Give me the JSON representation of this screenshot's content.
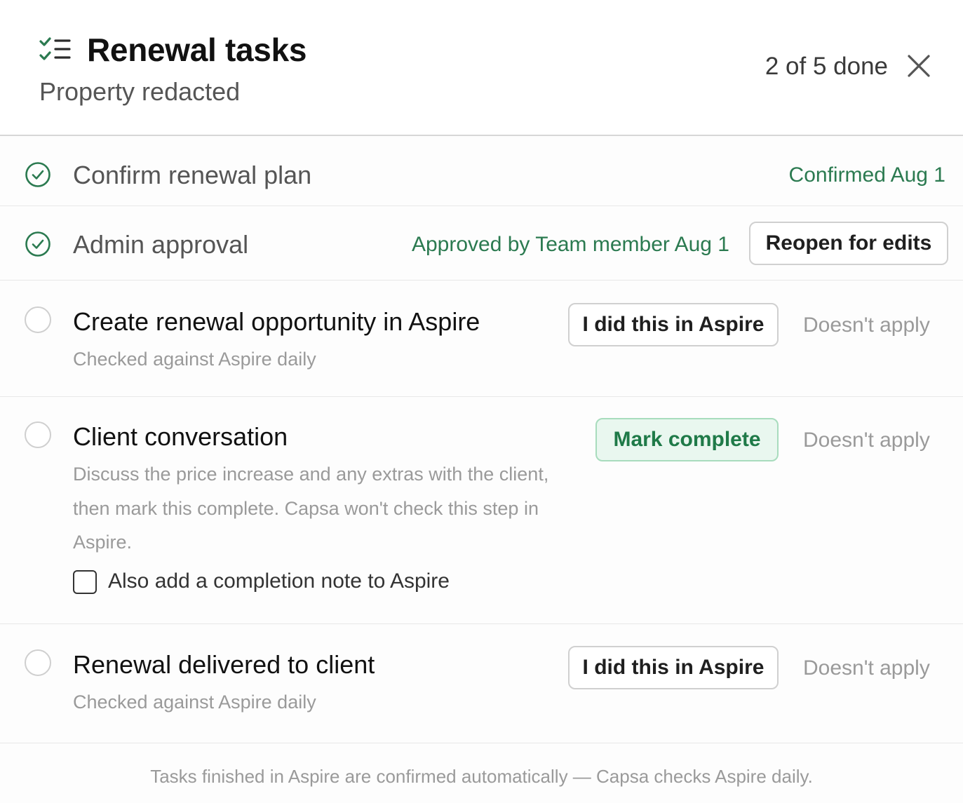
{
  "header": {
    "title": "Renewal tasks",
    "subtitle": "Property redacted",
    "progress": "2 of 5 done",
    "icon": "checklist-icon",
    "close_icon": "close-icon"
  },
  "tasks": [
    {
      "title": "Confirm renewal plan",
      "state": "done",
      "status": "Confirmed Aug 1"
    },
    {
      "title": "Admin approval",
      "state": "done",
      "status": "Approved by Team member Aug 1",
      "action": "Reopen for edits"
    },
    {
      "title": "Create renewal opportunity in Aspire",
      "state": "todo",
      "subtitle": "Checked against Aspire daily",
      "action": "I did this in Aspire",
      "skip": "Doesn't apply"
    },
    {
      "title": "Client conversation",
      "state": "todo",
      "description": "Discuss the price increase and any extras with the client, then mark this complete. Capsa won't check this step in Aspire.",
      "action": "Mark complete",
      "skip": "Doesn't apply",
      "checkbox_label": "Also add a completion note to Aspire",
      "checkbox_checked": false
    },
    {
      "title": "Renewal delivered to client",
      "state": "todo",
      "subtitle": "Checked against Aspire daily",
      "action": "I did this in Aspire",
      "skip": "Doesn't apply"
    }
  ],
  "footer": "Tasks finished in Aspire are confirmed automatically — Capsa checks Aspire daily.",
  "colors": {
    "accent_green": "#2b7a50",
    "button_green_bg": "#e9f7ef",
    "muted": "#9a9a9a"
  }
}
